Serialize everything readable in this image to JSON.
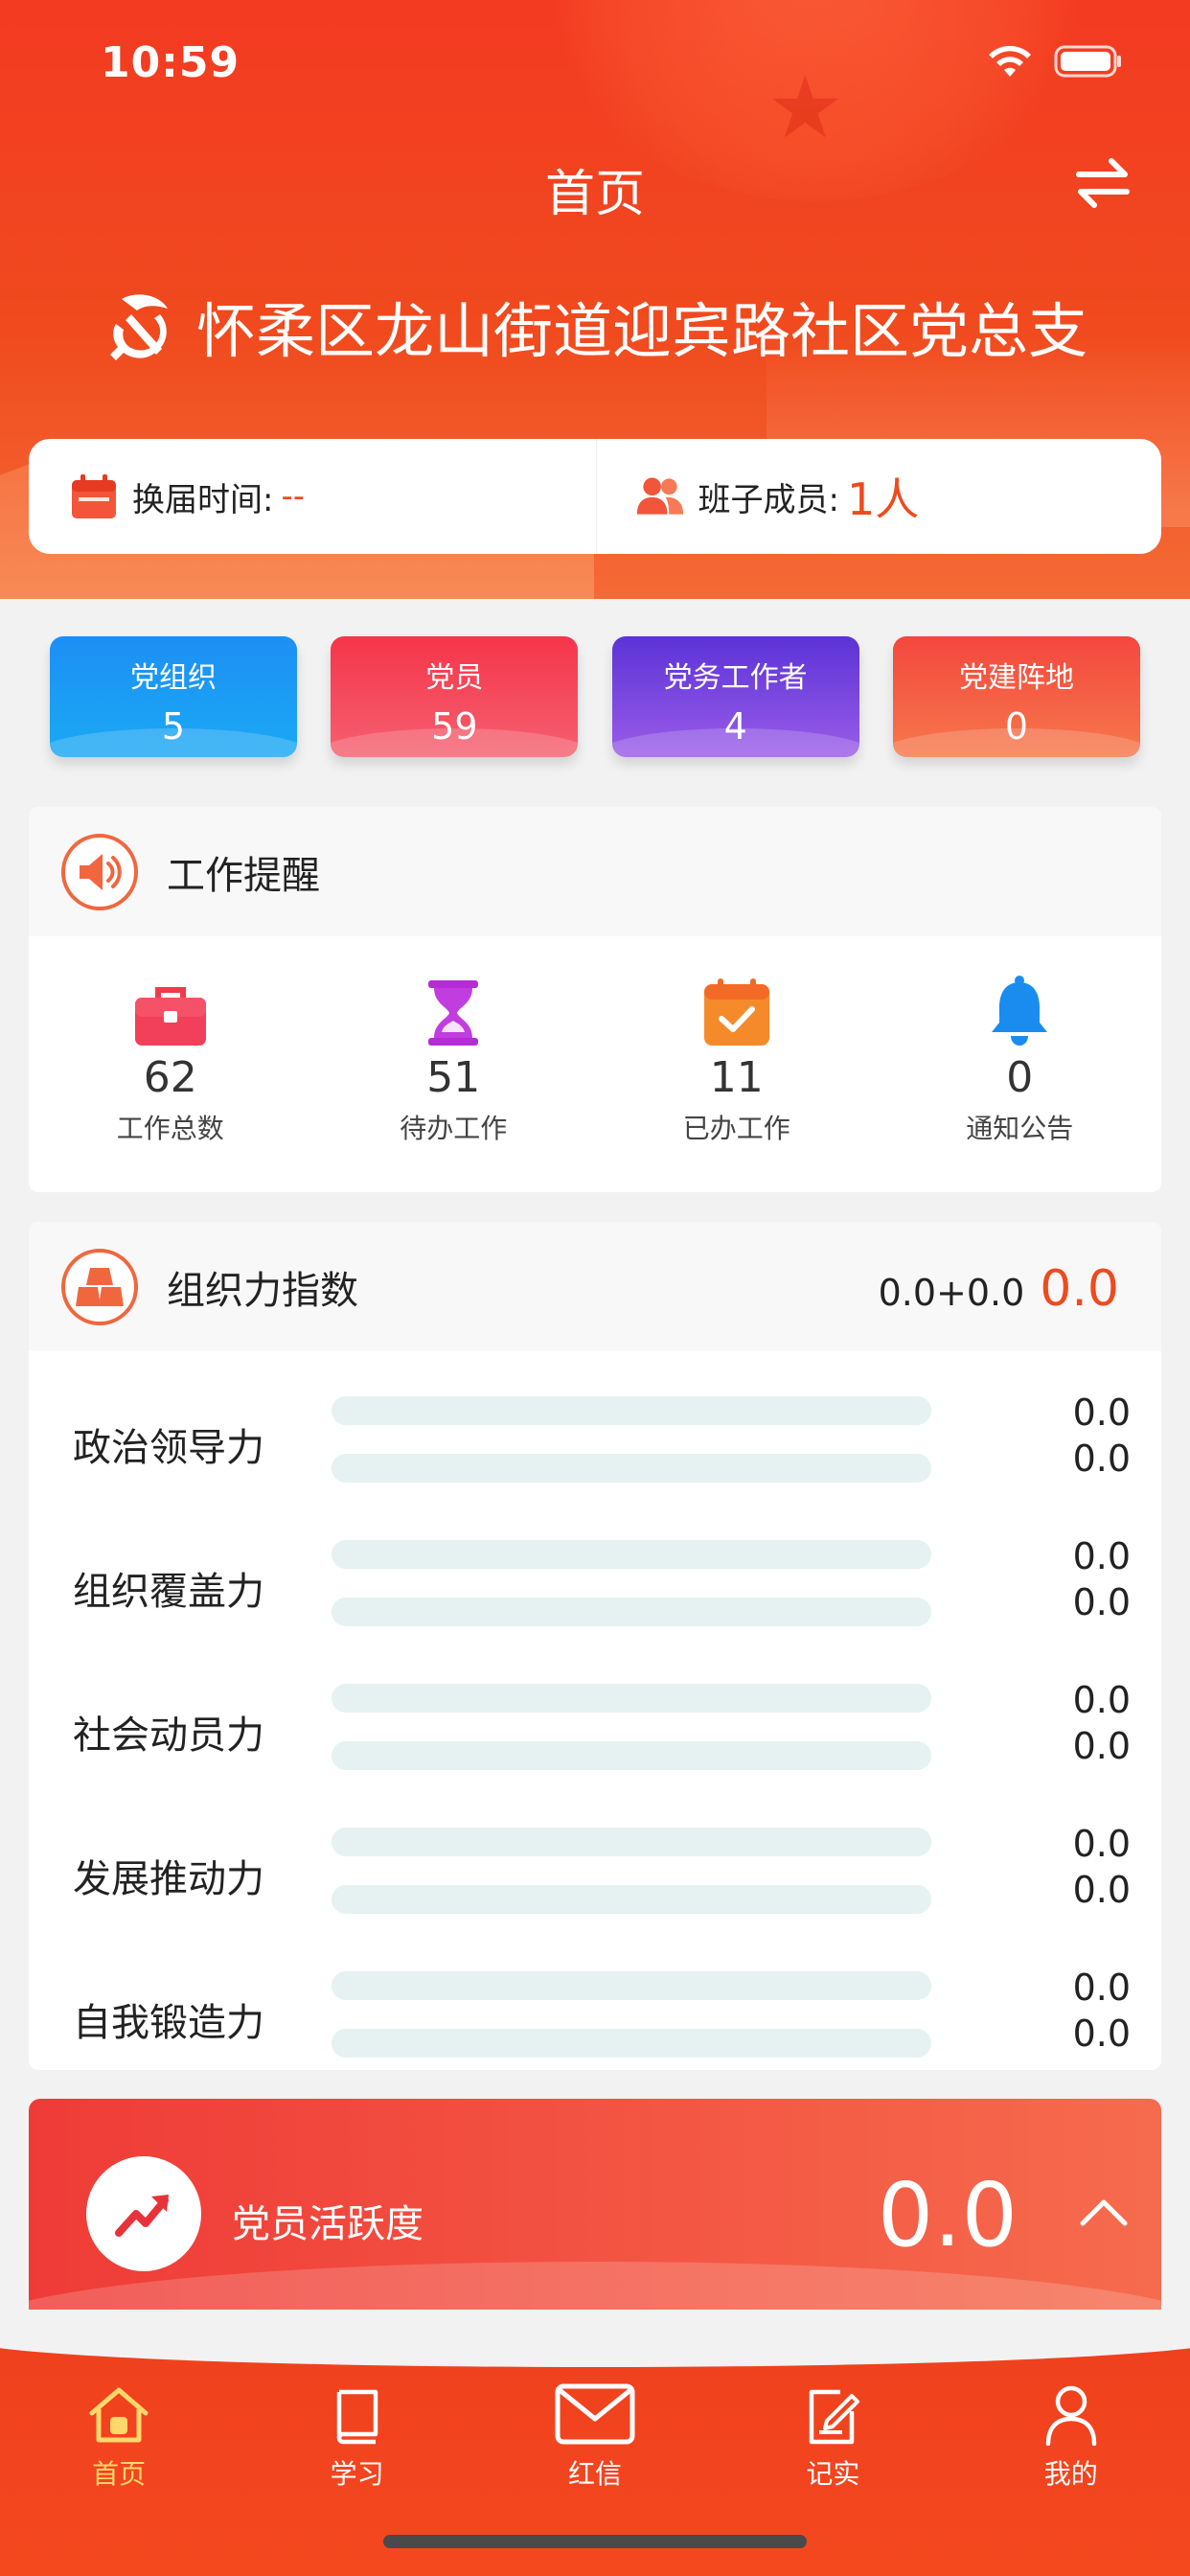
{
  "status_bar": {
    "time": "10:59"
  },
  "header": {
    "title": "首页",
    "org_name": "怀柔区龙山街道迎宾路社区党总支"
  },
  "info": {
    "term_label": "换届时间:",
    "term_value": "--",
    "members_label": "班子成员:",
    "members_value": "1人"
  },
  "tiles": [
    {
      "label": "党组织",
      "value": "5"
    },
    {
      "label": "党员",
      "value": "59"
    },
    {
      "label": "党务工作者",
      "value": "4"
    },
    {
      "label": "党建阵地",
      "value": "0"
    }
  ],
  "reminder": {
    "title": "工作提醒",
    "items": [
      {
        "count": "62",
        "label": "工作总数",
        "icon": "briefcase-icon"
      },
      {
        "count": "51",
        "label": "待办工作",
        "icon": "hourglass-icon"
      },
      {
        "count": "11",
        "label": "已办工作",
        "icon": "calendar-check-icon"
      },
      {
        "count": "0",
        "label": "通知公告",
        "icon": "bell-icon"
      }
    ]
  },
  "org_index": {
    "title": "组织力指数",
    "formula": "0.0+0.0",
    "total": "0.0",
    "rows": [
      {
        "label": "政治领导力",
        "v1": "0.0",
        "v2": "0.0"
      },
      {
        "label": "组织覆盖力",
        "v1": "0.0",
        "v2": "0.0"
      },
      {
        "label": "社会动员力",
        "v1": "0.0",
        "v2": "0.0"
      },
      {
        "label": "发展推动力",
        "v1": "0.0",
        "v2": "0.0"
      },
      {
        "label": "自我锻造力",
        "v1": "0.0",
        "v2": "0.0"
      }
    ]
  },
  "activity": {
    "label": "党员活跃度",
    "value": "0.0"
  },
  "tabbar": [
    {
      "label": "首页",
      "icon": "home-icon",
      "active": true
    },
    {
      "label": "学习",
      "icon": "book-icon",
      "active": false
    },
    {
      "label": "红信",
      "icon": "mail-icon",
      "active": false
    },
    {
      "label": "记实",
      "icon": "edit-note-icon",
      "active": false
    },
    {
      "label": "我的",
      "icon": "user-icon",
      "active": false
    }
  ],
  "colors": {
    "brand_red": "#ee4a1e",
    "tab_active": "#ffd76a",
    "tile_blue": "#1d8ff5",
    "tile_red": "#f5354a",
    "tile_purple": "#6a3fdc",
    "tile_orange": "#f4473f",
    "bar_track": "#e6f1f2"
  }
}
